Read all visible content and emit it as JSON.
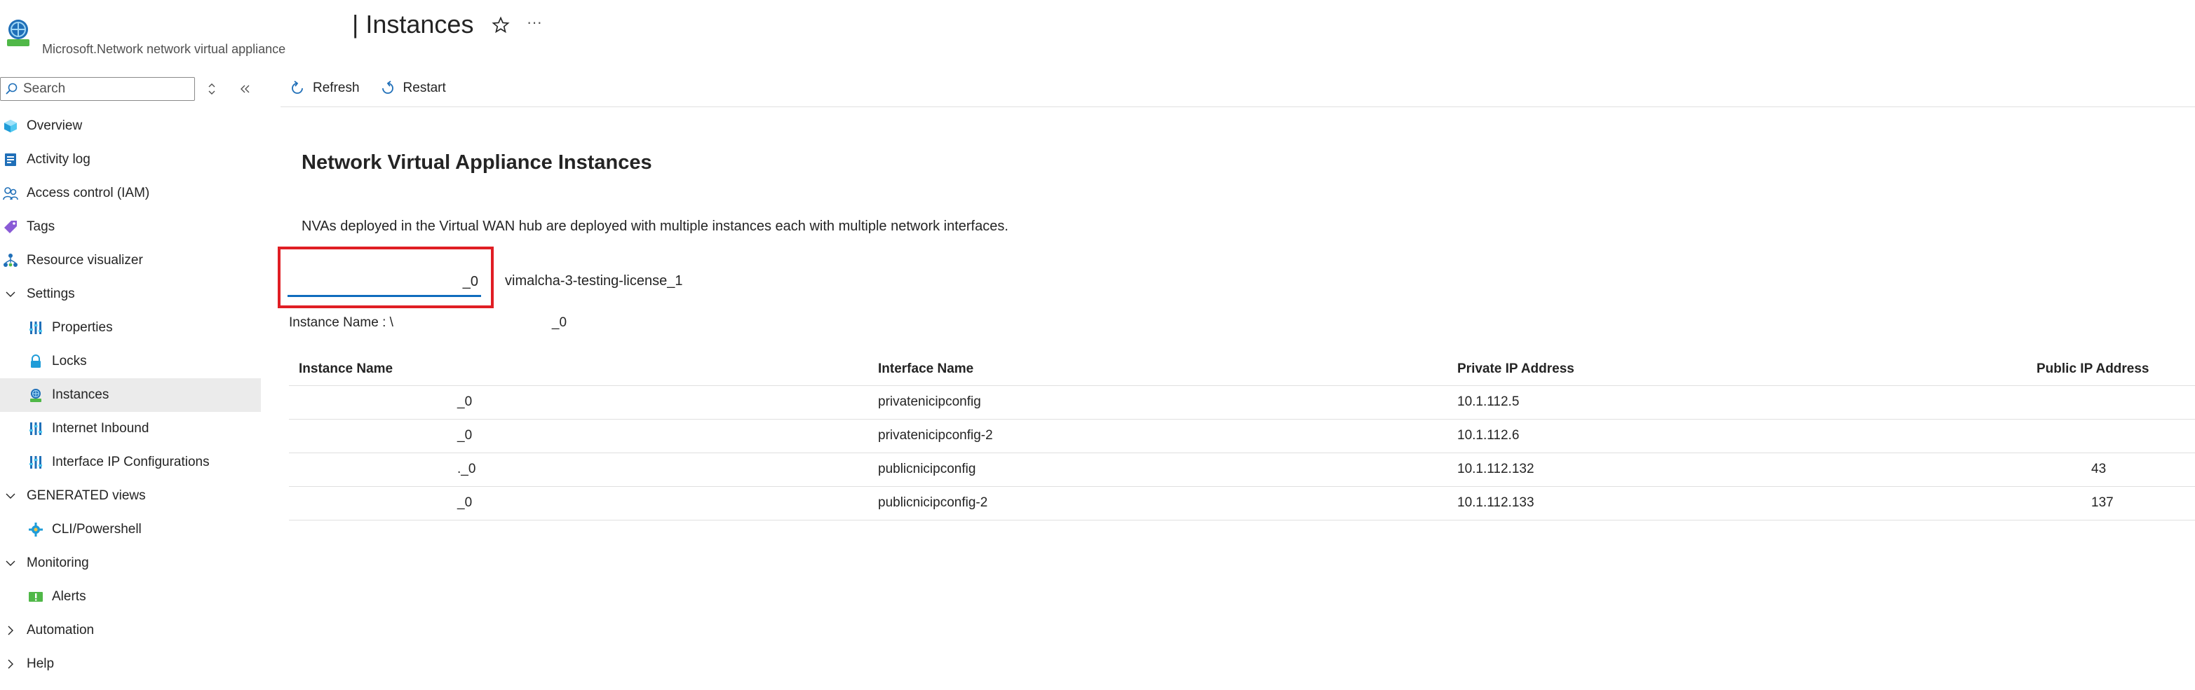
{
  "header": {
    "title": "| Instances",
    "subtitle": "Microsoft.Network network virtual appliance",
    "more_label": "···"
  },
  "sidebar": {
    "search_placeholder": "Search",
    "items": [
      {
        "label": "Overview",
        "icon": "overview-cube-icon",
        "level": 0
      },
      {
        "label": "Activity log",
        "icon": "activity-log-icon",
        "level": 0
      },
      {
        "label": "Access control (IAM)",
        "icon": "people-icon",
        "level": 0
      },
      {
        "label": "Tags",
        "icon": "tag-icon",
        "level": 0
      },
      {
        "label": "Resource visualizer",
        "icon": "hierarchy-icon",
        "level": 0
      },
      {
        "label": "Settings",
        "icon": "chevron-down-icon",
        "level": "group"
      },
      {
        "label": "Properties",
        "icon": "properties-bars-icon",
        "level": 1
      },
      {
        "label": "Locks",
        "icon": "lock-icon",
        "level": 1
      },
      {
        "label": "Instances",
        "icon": "instances-icon",
        "level": 1,
        "active": true
      },
      {
        "label": "Internet Inbound",
        "icon": "properties-bars-icon",
        "level": 1
      },
      {
        "label": "Interface IP Configurations",
        "icon": "properties-bars-icon",
        "level": 1
      },
      {
        "label": "GENERATED views",
        "icon": "chevron-down-icon",
        "level": "group"
      },
      {
        "label": "CLI/Powershell",
        "icon": "gear-icon",
        "level": 1
      },
      {
        "label": "Monitoring",
        "icon": "chevron-down-icon",
        "level": "group"
      },
      {
        "label": "Alerts",
        "icon": "alerts-icon",
        "level": 1
      },
      {
        "label": "Automation",
        "icon": "chevron-right-icon",
        "level": "group"
      },
      {
        "label": "Help",
        "icon": "chevron-right-icon",
        "level": "group"
      }
    ]
  },
  "toolbar": {
    "refresh_label": "Refresh",
    "restart_label": "Restart"
  },
  "content": {
    "section_title": "Network Virtual Appliance Instances",
    "description": "NVAs deployed in the Virtual WAN hub are deployed with multiple instances each with multiple network interfaces.",
    "instance_select_value": "_0",
    "license_label": "vimalcha-3-testing-license_1",
    "instance_name_label": "Instance Name : \\",
    "instance_name_value": "_0"
  },
  "table": {
    "columns": [
      "Instance Name",
      "Interface Name",
      "Private IP Address",
      "Public IP Address"
    ],
    "rows": [
      [
        "_0",
        "privatenicipconfig",
        "10.1.112.5",
        ""
      ],
      [
        "_0",
        "privatenicipconfig-2",
        "10.1.112.6",
        ""
      ],
      [
        "._0",
        "publicnicipconfig",
        "10.1.112.132",
        "43"
      ],
      [
        "_0",
        "publicnicipconfig-2",
        "10.1.112.133",
        "137"
      ]
    ]
  },
  "colors": {
    "accent": "#0f6cbd",
    "highlight": "#e01e24",
    "active_bg": "#ebebeb"
  }
}
